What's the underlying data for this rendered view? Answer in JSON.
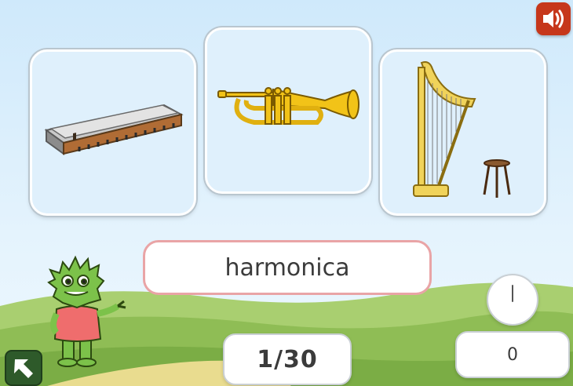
{
  "game": {
    "current_word": "harmonica",
    "progress": "1/30",
    "score": "0",
    "timer_value": null
  },
  "cards": [
    {
      "name": "harmonica",
      "icon": "harmonica-icon"
    },
    {
      "name": "trumpet",
      "icon": "trumpet-icon"
    },
    {
      "name": "harp",
      "icon": "harp-icon"
    }
  ],
  "controls": {
    "sound_icon": "speaker-icon",
    "back_icon": "arrow-up-left-icon"
  },
  "colors": {
    "sound_button": "#c6371b",
    "back_button": "#2e5a2a",
    "word_border": "#e9a4a6",
    "card_bg": "#dff0fc"
  }
}
